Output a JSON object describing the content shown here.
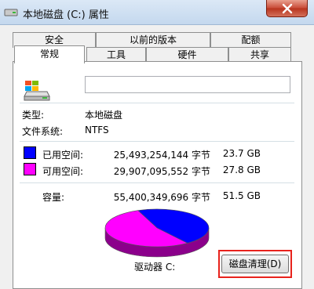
{
  "window": {
    "title": "本地磁盘 (C:) 属性",
    "close_label": "×"
  },
  "tabs": {
    "row1": [
      "安全",
      "以前的版本",
      "配额"
    ],
    "row2": [
      "常规",
      "工具",
      "硬件",
      "共享"
    ],
    "active": "常规"
  },
  "general": {
    "name_value": "",
    "type_label": "类型:",
    "type_value": "本地磁盘",
    "fs_label": "文件系统:",
    "fs_value": "NTFS",
    "used": {
      "label": "已用空间:",
      "bytes": "25,493,254,144 字节",
      "size": "23.7 GB",
      "color": "#0000ff"
    },
    "free": {
      "label": "可用空间:",
      "bytes": "29,907,095,552 字节",
      "size": "27.8 GB",
      "color": "#ff00ff"
    },
    "capacity": {
      "label": "容量:",
      "bytes": "55,400,349,696 字节",
      "size": "51.5 GB"
    },
    "drive_label": "驱动器 C:",
    "cleanup_button": "磁盘清理(D)"
  },
  "chart_data": {
    "type": "pie",
    "categories": [
      "已用空间",
      "可用空间"
    ],
    "values": [
      23.7,
      27.8
    ],
    "colors": [
      "#0000ff",
      "#ff00ff"
    ]
  }
}
